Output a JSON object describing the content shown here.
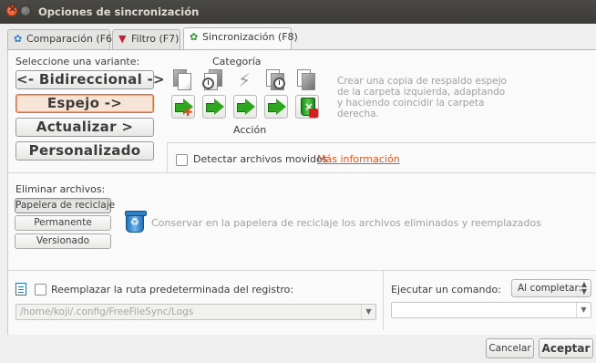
{
  "window": {
    "title": "Opciones de sincronización"
  },
  "tabs": [
    {
      "label": "Comparación (F6)",
      "icon": "gear-icon"
    },
    {
      "label": "Filtro (F7)",
      "icon": "funnel-icon"
    },
    {
      "label": "Sincronización (F8)",
      "icon": "gear-icon",
      "active": true
    }
  ],
  "variant": {
    "label": "Seleccione una variante:",
    "buttons": [
      "<- Bidireccional ->",
      "Espejo ->",
      "Actualizar >",
      "Personalizado"
    ],
    "selected": "Espejo ->"
  },
  "categories": {
    "header": "Categoría",
    "action_header": "Acción",
    "icons": [
      "file-left-only-icon",
      "file-left-newer-icon",
      "file-different-icon",
      "file-right-newer-icon",
      "file-right-only-icon"
    ],
    "actions": [
      "create-right-icon",
      "copy-right-icon",
      "copy-right-icon",
      "copy-right-icon",
      "delete-right-icon"
    ]
  },
  "description": "Crear una copia de respaldo espejo de la carpeta izquierda, adaptando y haciendo coincidir la carpeta derecha.",
  "detect_moved": {
    "label": "Detectar archivos movidos",
    "checked": false,
    "more_info_link": "Más información"
  },
  "delete_files": {
    "label": "Eliminar archivos:",
    "buttons": [
      "Papelera de reciclaje",
      "Permanente",
      "Versionado"
    ],
    "selected": "Papelera de reciclaje",
    "description": "Conservar en la papelera de reciclaje los archivos eliminados y reemplazados"
  },
  "log": {
    "checkbox_label": "Reemplazar la ruta predeterminada del registro:",
    "checked": false,
    "path": "/home/koji/.config/FreeFileSync/Logs"
  },
  "command": {
    "label": "Ejecutar un comando:",
    "when_selected": "Al completar:",
    "value": ""
  },
  "footer": {
    "cancel": "Cancelar",
    "accept": "Aceptar"
  },
  "colors": {
    "accent": "#e0561f",
    "green": "#2fa61f",
    "titlebar": "#3c3b37"
  }
}
